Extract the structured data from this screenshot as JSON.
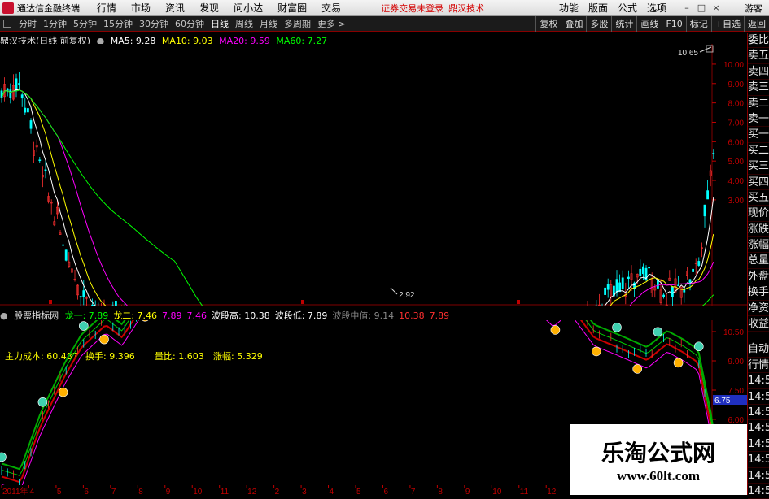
{
  "menubar": {
    "app_title": "通达信金融终端",
    "items": [
      "行情",
      "市场",
      "资讯",
      "发现",
      "问小达",
      "财富圈",
      "交易"
    ],
    "login_note": "证券交易未登录",
    "login_brand": "鼎汉技术",
    "right_items": [
      "功能",
      "版面",
      "公式",
      "选项"
    ],
    "window_buttons": [
      "–",
      "□",
      "×"
    ],
    "guest": "游客"
  },
  "toolbar": {
    "periods": [
      "分时",
      "1分钟",
      "5分钟",
      "15分钟",
      "30分钟",
      "60分钟",
      "日线",
      "周线",
      "月线",
      "多周期",
      "更多 >"
    ],
    "active_period": "日线",
    "right_buttons": [
      "复权",
      "叠加",
      "多股",
      "统计",
      "画线",
      "F10",
      "标记",
      "+自选",
      "返回"
    ]
  },
  "main_info": {
    "stock": "鼎汉技术(日线 前复权)",
    "ma": [
      {
        "label": "MA5: 9.28",
        "color": "#ffffff"
      },
      {
        "label": "MA10: 9.03",
        "color": "#ffff00"
      },
      {
        "label": "MA20: 9.59",
        "color": "#ff00ff"
      },
      {
        "label": "MA60: 7.27",
        "color": "#00ff00"
      }
    ]
  },
  "main_axis": {
    "labels": [
      "10.00",
      "9.00",
      "8.00",
      "7.00",
      "6.00",
      "5.00",
      "4.00",
      "3.00"
    ],
    "high_marker": "10.65",
    "low_marker": "2.92"
  },
  "sub_info": {
    "indicator": "股票指标网",
    "fields": [
      {
        "label": "龙一: 7.89",
        "color": "#00ff00"
      },
      {
        "label": "龙二: 7.46",
        "color": "#ffff00"
      },
      {
        "label": "7.89",
        "color": "#ff00ff"
      },
      {
        "label": "7.46",
        "color": "#ff00ff"
      },
      {
        "label": "波段高: 10.38",
        "color": "#ffffff"
      },
      {
        "label": "波段低: 7.89",
        "color": "#ffffff"
      },
      {
        "label": "波段中值: 9.14",
        "color": "#888888"
      },
      {
        "label": "10.38",
        "color": "#ff3030"
      },
      {
        "label": "7.89",
        "color": "#ff3030"
      }
    ],
    "stats": [
      {
        "label": "主力成本: 60.487"
      },
      {
        "label": "换手: 9.396"
      },
      {
        "label": "量比: 1.603"
      },
      {
        "label": "涨幅: 5.329"
      }
    ]
  },
  "sub_axis": {
    "labels": [
      "10.50",
      "9.00",
      "7.50",
      "6.00"
    ],
    "current_tag": "6.75"
  },
  "xaxis": {
    "labels": [
      "2011年",
      "4",
      "5",
      "6",
      "7",
      "8",
      "9",
      "10",
      "11",
      "12",
      "2",
      "3",
      "4",
      "5",
      "6",
      "7",
      "8",
      "9",
      "10",
      "11",
      "12",
      "2",
      "3",
      "4",
      "5",
      "6",
      "7"
    ]
  },
  "right_panel": {
    "items_top": [
      "委比",
      "卖五",
      "卖四",
      "卖三",
      "卖二",
      "卖一",
      "买一",
      "买二",
      "买三",
      "买四",
      "买五",
      "现价",
      "涨跌",
      "涨幅",
      "总量",
      "外盘",
      "换手",
      "净资",
      "收益"
    ],
    "items_bottom": [
      "自动",
      "行情",
      "14:5",
      "14:5",
      "14:5",
      "14:5",
      "14:5",
      "14:5",
      "14:5",
      "14:5"
    ]
  },
  "watermark": {
    "title": "乐淘公式网",
    "url": "www.60lt.com"
  },
  "colors": {
    "up": "#ff3030",
    "down": "#00ffff",
    "ma5": "#ffffff",
    "ma10": "#ffff00",
    "ma20": "#ff00ff",
    "ma60": "#00ff00",
    "grid": "#800000"
  }
}
